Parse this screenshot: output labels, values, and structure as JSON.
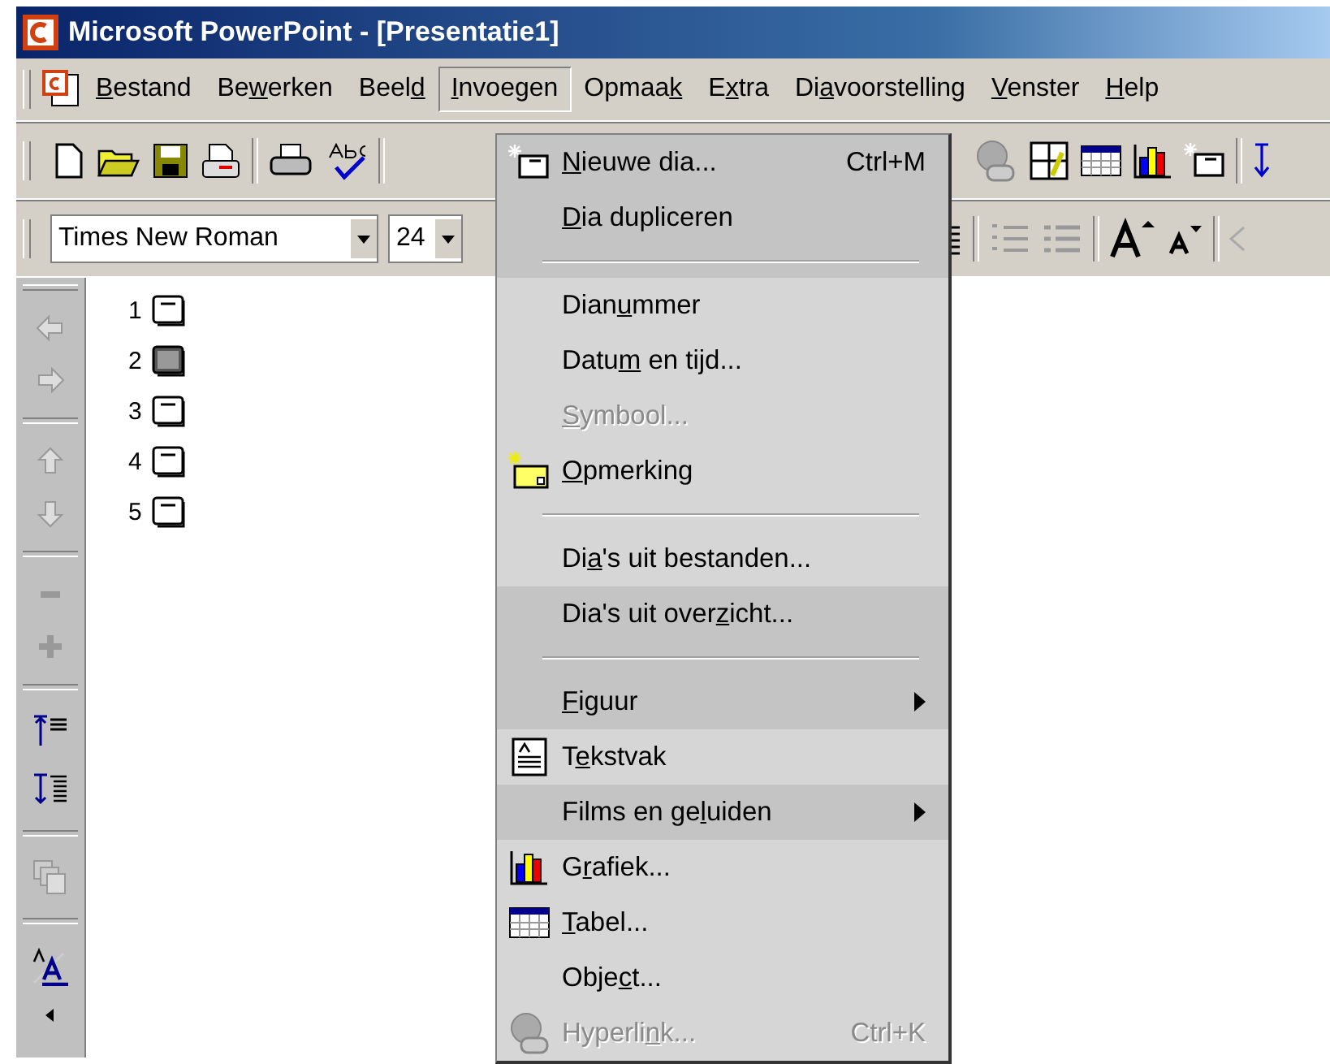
{
  "window": {
    "title": "Microsoft PowerPoint - [Presentatie1]"
  },
  "menu_bar": [
    {
      "label": "Bestand",
      "selected": false
    },
    {
      "label": "Bewerken",
      "selected": false
    },
    {
      "label": "Beeld",
      "selected": false
    },
    {
      "label": "Invoegen",
      "selected": true
    },
    {
      "label": "Opmaak",
      "selected": false
    },
    {
      "label": "Extra",
      "selected": false
    },
    {
      "label": "Diavoorstelling",
      "selected": false
    },
    {
      "label": "Venster",
      "selected": false
    },
    {
      "label": "Help",
      "selected": false
    }
  ],
  "formatting_toolbar": {
    "font": "Times New Roman",
    "size": "24"
  },
  "outline": [
    {
      "number": "1",
      "selected": false
    },
    {
      "number": "2",
      "selected": true
    },
    {
      "number": "3",
      "selected": false
    },
    {
      "number": "4",
      "selected": false
    },
    {
      "number": "5",
      "selected": false
    }
  ],
  "menu": [
    {
      "kind": "item",
      "label": "Nieuwe dia...",
      "shortcut": "Ctrl+M",
      "recent": true,
      "disabled": false,
      "submenu": false
    },
    {
      "kind": "item",
      "label": "Dia dupliceren",
      "recent": true,
      "disabled": false,
      "submenu": false
    },
    {
      "kind": "separator"
    },
    {
      "kind": "item",
      "label": "Dianummer",
      "recent": false,
      "disabled": false,
      "submenu": false
    },
    {
      "kind": "item",
      "label": "Datum en tijd...",
      "recent": false,
      "disabled": false,
      "submenu": false
    },
    {
      "kind": "item",
      "label": "Symbool...",
      "recent": false,
      "disabled": true,
      "submenu": false
    },
    {
      "kind": "item",
      "label": "Opmerking",
      "recent": false,
      "disabled": false,
      "submenu": false
    },
    {
      "kind": "separator"
    },
    {
      "kind": "item",
      "label": "Dia's uit bestanden...",
      "recent": false,
      "disabled": false,
      "submenu": false
    },
    {
      "kind": "item",
      "label": "Dia's uit overzicht...",
      "recent": true,
      "disabled": false,
      "submenu": false
    },
    {
      "kind": "separator"
    },
    {
      "kind": "item",
      "label": "Figuur",
      "recent": true,
      "disabled": false,
      "submenu": true
    },
    {
      "kind": "item",
      "label": "Tekstvak",
      "recent": false,
      "disabled": false,
      "submenu": false
    },
    {
      "kind": "item",
      "label": "Films en geluiden",
      "recent": true,
      "disabled": false,
      "submenu": true
    },
    {
      "kind": "item",
      "label": "Grafiek...",
      "recent": false,
      "disabled": false,
      "submenu": false
    },
    {
      "kind": "item",
      "label": "Tabel...",
      "recent": false,
      "disabled": false,
      "submenu": false
    },
    {
      "kind": "item",
      "label": "Object...",
      "recent": false,
      "disabled": false,
      "submenu": false
    },
    {
      "kind": "item",
      "label": "Hyperlink...",
      "shortcut": "Ctrl+K",
      "recent": false,
      "disabled": true,
      "submenu": false
    }
  ]
}
